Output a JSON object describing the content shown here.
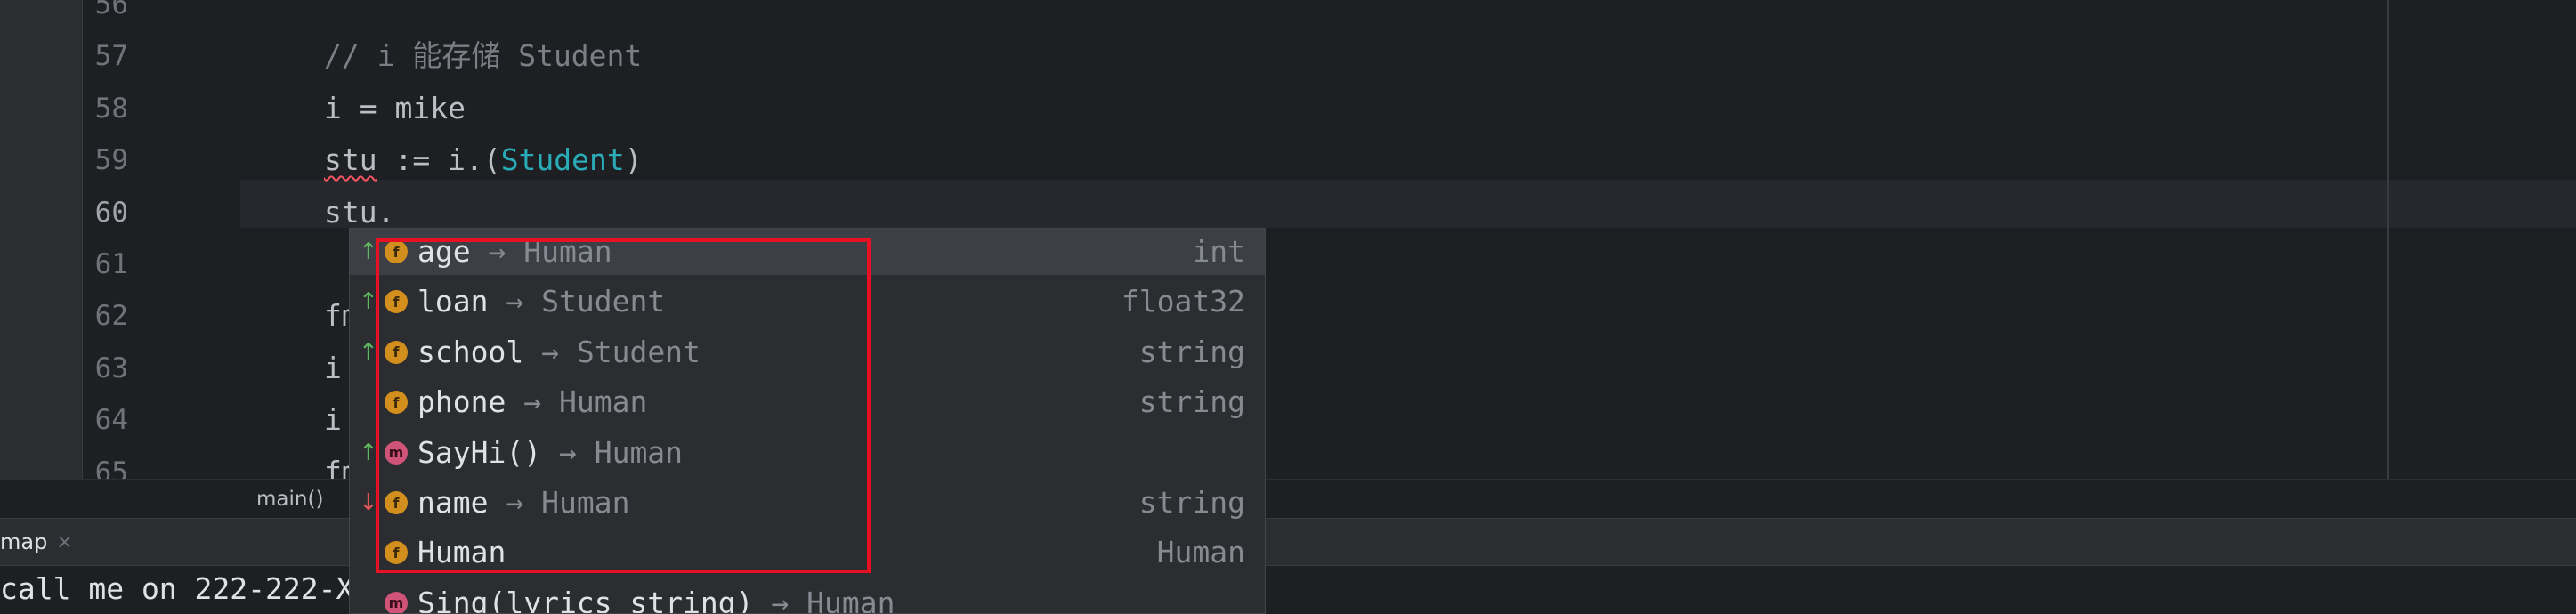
{
  "editor": {
    "lines": [
      {
        "number": "56",
        "parts": []
      },
      {
        "number": "57",
        "parts": [
          {
            "text": "// i 能存储 Student",
            "cls": "cm"
          }
        ]
      },
      {
        "number": "58",
        "parts": [
          {
            "text": "i = mike",
            "cls": ""
          }
        ]
      },
      {
        "number": "59",
        "parts": [
          {
            "text": "stu",
            "cls": "err"
          },
          {
            "text": " := i.(",
            "cls": ""
          },
          {
            "text": "Student",
            "cls": "ty"
          },
          {
            "text": ")",
            "cls": ""
          }
        ]
      },
      {
        "number": "60",
        "parts": [
          {
            "text": "stu.",
            "cls": ""
          }
        ]
      },
      {
        "number": "61",
        "parts": []
      },
      {
        "number": "62",
        "parts": [
          {
            "text": "fmt.",
            "cls": ""
          }
        ]
      },
      {
        "number": "63",
        "parts": [
          {
            "text": "i = ",
            "cls": ""
          }
        ]
      },
      {
        "number": "64",
        "parts": [
          {
            "text": "i",
            "cls": ""
          }
        ]
      },
      {
        "number": "65",
        "parts": [
          {
            "text": "fmt.",
            "cls": ""
          }
        ]
      }
    ],
    "current_line": "60"
  },
  "breadcrumb": {
    "function": "main()"
  },
  "run_panel": {
    "tab_label": "map",
    "close_glyph": "×",
    "console_line": "call me on 222-222-XXX"
  },
  "completion": {
    "items": [
      {
        "kind": "f",
        "inherited": "up",
        "name": "age",
        "via": "Human",
        "type": "int",
        "selected": true
      },
      {
        "kind": "f",
        "inherited": "up",
        "name": "loan",
        "via": "Student",
        "type": "float32"
      },
      {
        "kind": "f",
        "inherited": "up",
        "name": "school",
        "via": "Student",
        "type": "string"
      },
      {
        "kind": "f",
        "inherited": "none",
        "name": "phone",
        "via": "Human",
        "type": "string"
      },
      {
        "kind": "m",
        "inherited": "up",
        "name": "SayHi()",
        "via": "Human",
        "type": ""
      },
      {
        "kind": "f",
        "inherited": "down",
        "name": "name",
        "via": "Human",
        "type": "string"
      },
      {
        "kind": "f",
        "inherited": "none",
        "name": "Human",
        "via": "",
        "type": "Human"
      },
      {
        "kind": "m",
        "inherited": "none",
        "name": "Sing(lyrics string)",
        "via": "Human",
        "type": ""
      }
    ],
    "arrow_glyph": "→",
    "badge_field": "f",
    "badge_method": "m"
  },
  "colors": {
    "highlight_box": "#e81123",
    "field_badge": "#d28f1e",
    "method_badge": "#d0537a"
  }
}
